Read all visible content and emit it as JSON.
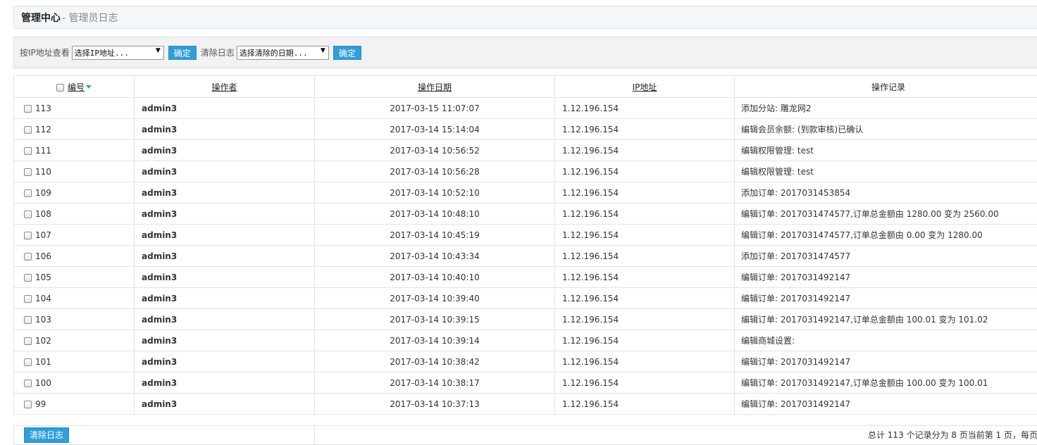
{
  "header": {
    "title": "管理中心",
    "subtitle": "- 管理员日志"
  },
  "filters": {
    "ip_label": "按IP地址查看",
    "ip_select_value": "选择IP地址...",
    "ip_confirm": "确定",
    "clear_label": "清除日志",
    "date_select_value": "选择清除的日期...",
    "date_confirm": "确定"
  },
  "table": {
    "columns": {
      "id": "编号",
      "operator": "操作者",
      "date": "操作日期",
      "ip": "IP地址",
      "record": "操作记录"
    },
    "rows": [
      {
        "id": "113",
        "operator": "admin3",
        "date": "2017-03-15 11:07:07",
        "ip": "1.12.196.154",
        "record": "添加分站: 雕龙网2"
      },
      {
        "id": "112",
        "operator": "admin3",
        "date": "2017-03-14 15:14:04",
        "ip": "1.12.196.154",
        "record": "编辑会员余额: (到款审核)已确认"
      },
      {
        "id": "111",
        "operator": "admin3",
        "date": "2017-03-14 10:56:52",
        "ip": "1.12.196.154",
        "record": "编辑权限管理: test"
      },
      {
        "id": "110",
        "operator": "admin3",
        "date": "2017-03-14 10:56:28",
        "ip": "1.12.196.154",
        "record": "编辑权限管理: test"
      },
      {
        "id": "109",
        "operator": "admin3",
        "date": "2017-03-14 10:52:10",
        "ip": "1.12.196.154",
        "record": "添加订单: 2017031453854"
      },
      {
        "id": "108",
        "operator": "admin3",
        "date": "2017-03-14 10:48:10",
        "ip": "1.12.196.154",
        "record": "编辑订单: 2017031474577,订单总金额由 1280.00 变为 2560.00"
      },
      {
        "id": "107",
        "operator": "admin3",
        "date": "2017-03-14 10:45:19",
        "ip": "1.12.196.154",
        "record": "编辑订单: 2017031474577,订单总金额由 0.00 变为 1280.00"
      },
      {
        "id": "106",
        "operator": "admin3",
        "date": "2017-03-14 10:43:34",
        "ip": "1.12.196.154",
        "record": "添加订单: 2017031474577"
      },
      {
        "id": "105",
        "operator": "admin3",
        "date": "2017-03-14 10:40:10",
        "ip": "1.12.196.154",
        "record": "编辑订单: 2017031492147"
      },
      {
        "id": "104",
        "operator": "admin3",
        "date": "2017-03-14 10:39:40",
        "ip": "1.12.196.154",
        "record": "编辑订单: 2017031492147"
      },
      {
        "id": "103",
        "operator": "admin3",
        "date": "2017-03-14 10:39:15",
        "ip": "1.12.196.154",
        "record": "编辑订单: 2017031492147,订单总金额由 100.01 变为 101.02"
      },
      {
        "id": "102",
        "operator": "admin3",
        "date": "2017-03-14 10:39:14",
        "ip": "1.12.196.154",
        "record": "编辑商城设置:"
      },
      {
        "id": "101",
        "operator": "admin3",
        "date": "2017-03-14 10:38:42",
        "ip": "1.12.196.154",
        "record": "编辑订单: 2017031492147"
      },
      {
        "id": "100",
        "operator": "admin3",
        "date": "2017-03-14 10:38:17",
        "ip": "1.12.196.154",
        "record": "编辑订单: 2017031492147,订单总金额由 100.00 变为 100.01"
      },
      {
        "id": "99",
        "operator": "admin3",
        "date": "2017-03-14 10:37:13",
        "ip": "1.12.196.154",
        "record": "编辑订单: 2017031492147"
      }
    ]
  },
  "footer": {
    "clear_button": "清除日志",
    "pagination_text": "总计 113 个记录分为 8 页当前第 1 页，每页"
  },
  "colors": {
    "accent": "#2f9fd8",
    "title_bg": "#f3f7fa",
    "filter_bg": "#f2f2f2"
  }
}
